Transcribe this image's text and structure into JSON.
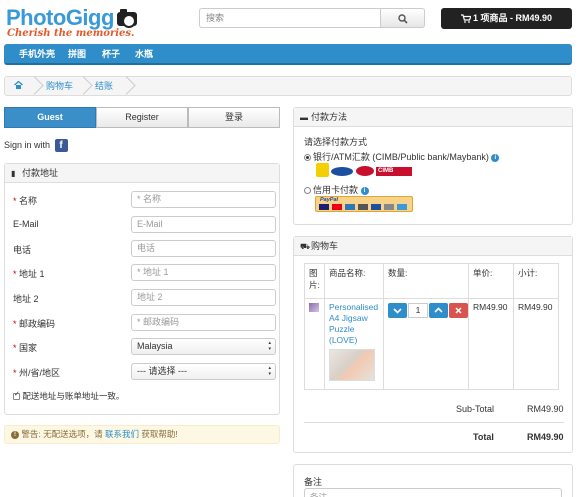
{
  "header": {
    "logo_title": "PhotoGigg",
    "logo_tagline": "Cherish the memories.",
    "search_placeholder": "搜索",
    "cart_summary": "1 项商品 - RM49.90"
  },
  "menu": [
    "手机外壳",
    "拼图",
    "杯子",
    "水瓶"
  ],
  "breadcrumb": [
    "购物车",
    "结账"
  ],
  "tabs": [
    "Guest",
    "Register",
    "登录"
  ],
  "signin_label": "Sign in with",
  "address": {
    "title": "付款地址",
    "fields": [
      {
        "label": "名称",
        "required": true,
        "placeholder": "* 名称"
      },
      {
        "label": "E-Mail",
        "required": false,
        "placeholder": "E-Mail"
      },
      {
        "label": "电话",
        "required": false,
        "placeholder": "电话"
      },
      {
        "label": "地址 1",
        "required": true,
        "placeholder": "* 地址 1"
      },
      {
        "label": "地址 2",
        "required": false,
        "placeholder": "地址 2"
      },
      {
        "label": "邮政编码",
        "required": true,
        "placeholder": "* 邮政编码"
      },
      {
        "label": "国家",
        "required": true,
        "value": "Malaysia"
      },
      {
        "label": "州/省/地区",
        "required": true,
        "value": "--- 请选择 ---"
      }
    ],
    "same_address": "配送地址与账单地址一致。"
  },
  "warning": {
    "prefix": "警告: 无配送选项，请",
    "link": "联系我们",
    "suffix": "获取帮助!"
  },
  "payment": {
    "title": "付款方法",
    "prompt": "请选择付款方式",
    "option1": "银行/ATM汇款 (CIMB/Public bank/Maybank)",
    "option2": "信用卡付款",
    "paypal": "PayPal"
  },
  "cart": {
    "title": "购物车",
    "headers": [
      "图片:",
      "商品名称:",
      "数量:",
      "单价:",
      "小计:"
    ],
    "item": {
      "name": "Personalised A4 Jigsaw Puzzle (LOVE)",
      "qty": "1",
      "price": "RM49.90",
      "subtotal": "RM49.90"
    },
    "subtotal_label": "Sub-Total",
    "subtotal_value": "RM49.90",
    "total_label": "Total",
    "total_value": "RM49.90"
  },
  "notes": {
    "label": "备注",
    "placeholder": "备注"
  },
  "colors": {
    "primary": "#2f8ec9",
    "header_dark": "#222222",
    "danger": "#d9534f"
  }
}
